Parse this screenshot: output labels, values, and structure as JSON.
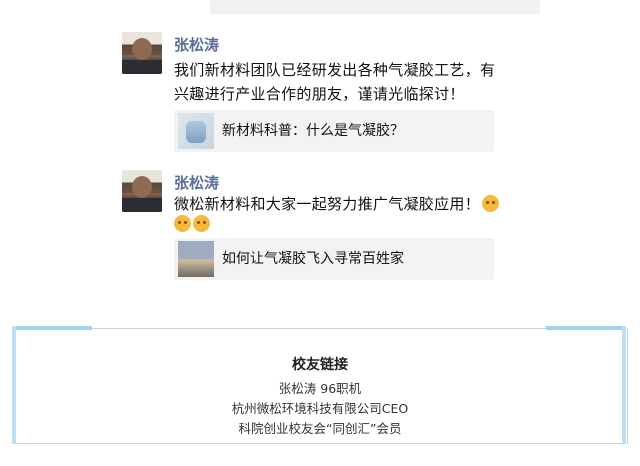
{
  "posts": [
    {
      "author": "张松涛",
      "message_line1": "我们新材料团队已经研发出各种气凝胶工艺，有",
      "message_line2": "兴趣进行产业合作的朋友，谨请光临探讨！",
      "link_title": "新材料科普：什么是气凝胶？"
    },
    {
      "author": "张松涛",
      "message_line1": "微松新材料和大家一起努力推广气凝胶应用！",
      "link_title": "如何让气凝胶飞入寻常百姓家"
    }
  ],
  "alumni_card": {
    "title": "校友链接",
    "line1": "张松涛 96职机",
    "line2": "杭州微松环境科技有限公司CEO",
    "line3": "科院创业校友会“同创汇”会员"
  },
  "colors": {
    "author_name": "#5b6f98",
    "card_border": "#bcd8ef",
    "card_accent": "#9fd2ef",
    "link_bg": "#f3f3f3"
  },
  "icons": [
    "avatar",
    "aerogel-thumbnail",
    "sky-thumbnail",
    "grinning-emoji"
  ]
}
